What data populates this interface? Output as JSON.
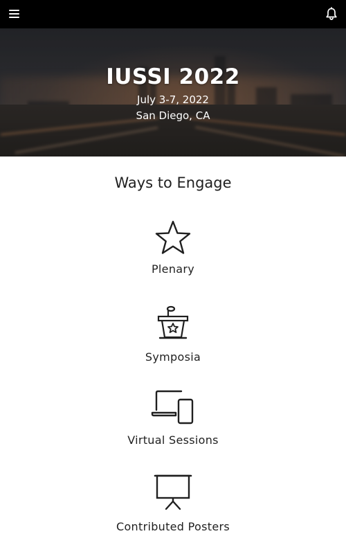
{
  "topbar": {
    "menu_icon": "hamburger-menu-icon",
    "notification_icon": "bell-icon",
    "background": "#000000"
  },
  "hero": {
    "title": "IUSSI 2022",
    "dates": "July 3-7, 2022",
    "location": "San Diego, CA"
  },
  "engage": {
    "heading": "Ways to Engage",
    "items": [
      {
        "label": "Plenary",
        "icon": "star-icon"
      },
      {
        "label": "Symposia",
        "icon": "podium-icon"
      },
      {
        "label": "Virtual Sessions",
        "icon": "laptop-phone-icon"
      },
      {
        "label": "Contributed Posters",
        "icon": "projector-screen-icon"
      }
    ]
  }
}
